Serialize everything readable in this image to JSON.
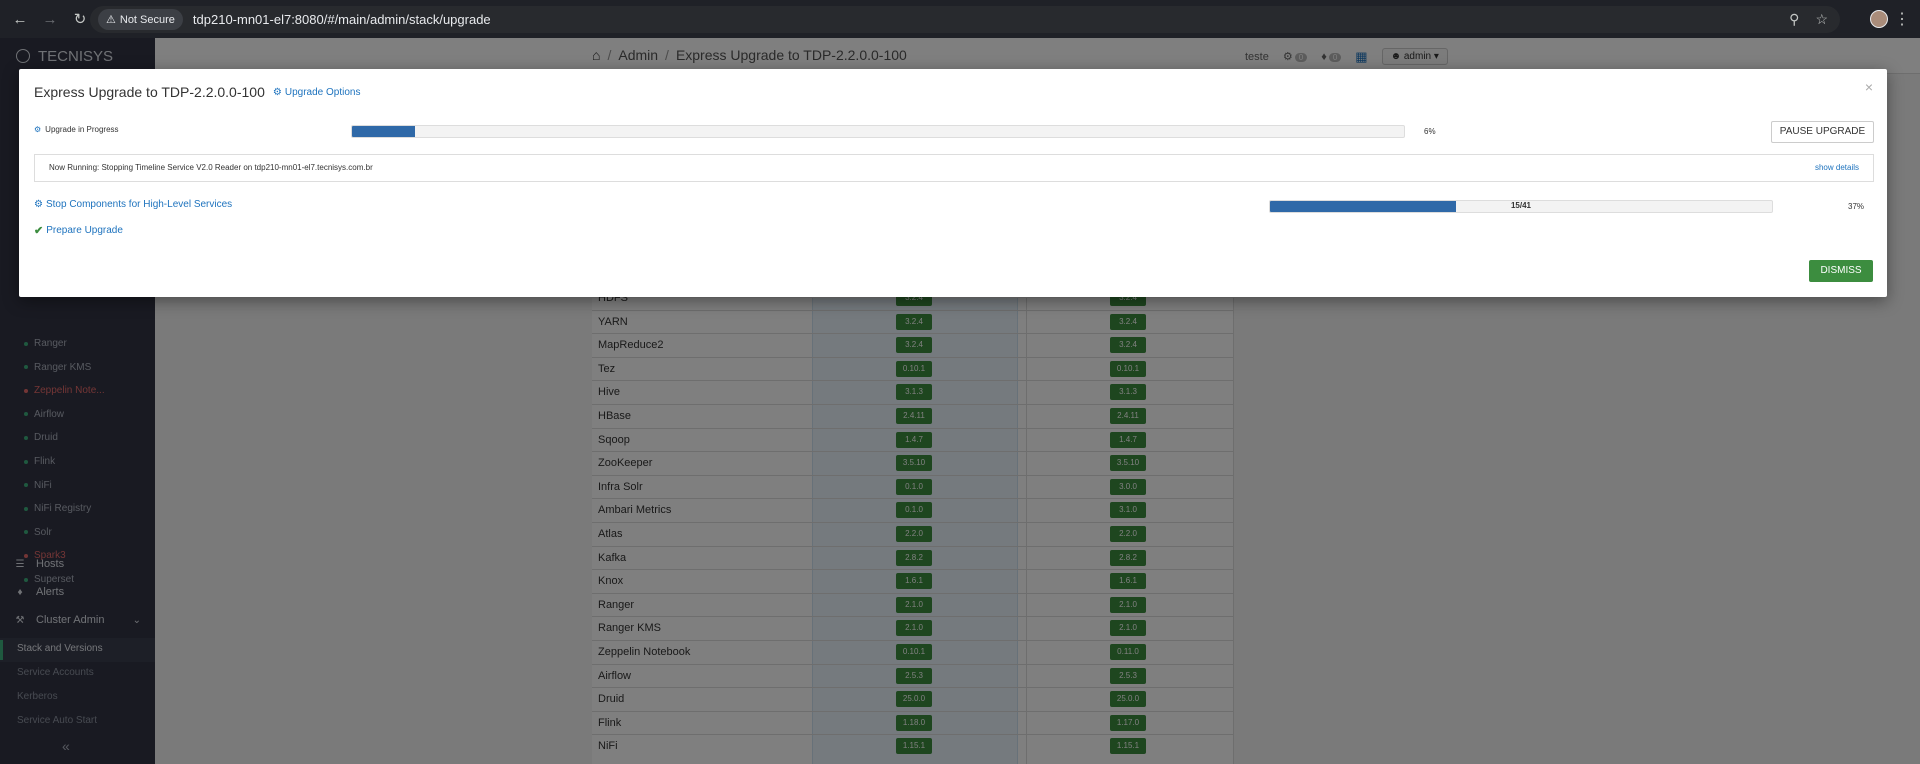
{
  "browser": {
    "security_label": "Not Secure",
    "url": "tdp210-mn01-el7:8080/#/main/admin/stack/upgrade"
  },
  "sidebar": {
    "brand": "TECNISYS",
    "services": [
      {
        "label": "Ranger",
        "status": "green"
      },
      {
        "label": "Ranger KMS",
        "status": "green"
      },
      {
        "label": "Zeppelin Note...",
        "status": "red"
      },
      {
        "label": "Airflow",
        "status": "green"
      },
      {
        "label": "Druid",
        "status": "green"
      },
      {
        "label": "Flink",
        "status": "green"
      },
      {
        "label": "NiFi",
        "status": "green"
      },
      {
        "label": "NiFi Registry",
        "status": "green"
      },
      {
        "label": "Solr",
        "status": "green"
      },
      {
        "label": "Spark3",
        "status": "red"
      },
      {
        "label": "Superset",
        "status": "green"
      }
    ],
    "hosts": "Hosts",
    "alerts": "Alerts",
    "cluster_admin": "Cluster Admin",
    "sub_items": [
      "Stack and Versions",
      "Service Accounts",
      "Kerberos",
      "Service Auto Start"
    ]
  },
  "topbar": {
    "breadcrumb": [
      "Admin",
      "Express Upgrade to TDP-2.2.0.0-100"
    ],
    "user_text": "teste",
    "ops_count": "0",
    "alerts_count": "0",
    "admin_label": "admin"
  },
  "versions": [
    {
      "service": "HDFS",
      "current": "3.2.4",
      "target": "3.2.4"
    },
    {
      "service": "YARN",
      "current": "3.2.4",
      "target": "3.2.4"
    },
    {
      "service": "MapReduce2",
      "current": "3.2.4",
      "target": "3.2.4"
    },
    {
      "service": "Tez",
      "current": "0.10.1",
      "target": "0.10.1"
    },
    {
      "service": "Hive",
      "current": "3.1.3",
      "target": "3.1.3"
    },
    {
      "service": "HBase",
      "current": "2.4.11",
      "target": "2.4.11"
    },
    {
      "service": "Sqoop",
      "current": "1.4.7",
      "target": "1.4.7"
    },
    {
      "service": "ZooKeeper",
      "current": "3.5.10",
      "target": "3.5.10"
    },
    {
      "service": "Infra Solr",
      "current": "0.1.0",
      "target": "3.0.0"
    },
    {
      "service": "Ambari Metrics",
      "current": "0.1.0",
      "target": "3.1.0"
    },
    {
      "service": "Atlas",
      "current": "2.2.0",
      "target": "2.2.0"
    },
    {
      "service": "Kafka",
      "current": "2.8.2",
      "target": "2.8.2"
    },
    {
      "service": "Knox",
      "current": "1.6.1",
      "target": "1.6.1"
    },
    {
      "service": "Ranger",
      "current": "2.1.0",
      "target": "2.1.0"
    },
    {
      "service": "Ranger KMS",
      "current": "2.1.0",
      "target": "2.1.0"
    },
    {
      "service": "Zeppelin Notebook",
      "current": "0.10.1",
      "target": "0.11.0"
    },
    {
      "service": "Airflow",
      "current": "2.5.3",
      "target": "2.5.3"
    },
    {
      "service": "Druid",
      "current": "25.0.0",
      "target": "25.0.0"
    },
    {
      "service": "Flink",
      "current": "1.18.0",
      "target": "1.17.0"
    },
    {
      "service": "NiFi",
      "current": "1.15.1",
      "target": "1.15.1"
    }
  ],
  "modal": {
    "title": "Express Upgrade to TDP-2.2.0.0-100",
    "options_link": "Upgrade Options",
    "status_label": "Upgrade in Progress",
    "overall_progress": 0.06,
    "overall_pct_text": "6%",
    "pause_label": "PAUSE UPGRADE",
    "now_running": "Now Running: Stopping Timeline Service V2.0 Reader on tdp210-mn01-el7.tecnisys.com.br",
    "show_details": "show details",
    "current_task": "Stop Components for High-Level Services",
    "task_progress": 0.37,
    "task_count_text": "15/41",
    "task_pct_text": "37%",
    "completed_task": "Prepare Upgrade",
    "dismiss_label": "DISMISS"
  }
}
